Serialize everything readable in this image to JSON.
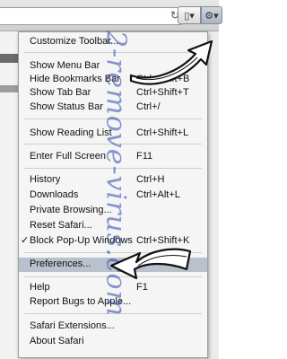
{
  "toolbar": {
    "reload_icon": "reload-icon",
    "page_button_icon": "page-icon",
    "gear_button_icon": "gear-icon",
    "page_glyph": "▯▾",
    "gear_glyph": "⚙▾"
  },
  "menu": {
    "items": [
      {
        "label": "Customize Toolbar...",
        "shortcut": ""
      },
      {
        "label": "Show Menu Bar",
        "shortcut": ""
      },
      {
        "label": "Hide Bookmarks Bar",
        "shortcut": "Ctrl+Shift+B"
      },
      {
        "label": "Show Tab Bar",
        "shortcut": "Ctrl+Shift+T"
      },
      {
        "label": "Show Status Bar",
        "shortcut": "Ctrl+/"
      },
      {
        "label": "Show Reading List",
        "shortcut": "Ctrl+Shift+L"
      },
      {
        "label": "Enter Full Screen",
        "shortcut": "F11"
      },
      {
        "label": "History",
        "shortcut": "Ctrl+H"
      },
      {
        "label": "Downloads",
        "shortcut": "Ctrl+Alt+L"
      },
      {
        "label": "Private Browsing...",
        "shortcut": ""
      },
      {
        "label": "Reset Safari...",
        "shortcut": ""
      },
      {
        "label": "Block Pop-Up Windows",
        "shortcut": "Ctrl+Shift+K",
        "checked": true
      },
      {
        "label": "Preferences...",
        "shortcut": ""
      },
      {
        "label": "Help",
        "shortcut": "F1"
      },
      {
        "label": "Report Bugs to Apple...",
        "shortcut": ""
      },
      {
        "label": "Safari Extensions...",
        "shortcut": ""
      },
      {
        "label": "About Safari",
        "shortcut": ""
      }
    ],
    "check_mark": "✓",
    "highlight_color": "#b9c1cc"
  },
  "watermark": {
    "text": "2-remove-virus.com",
    "color": "#2846aa"
  }
}
